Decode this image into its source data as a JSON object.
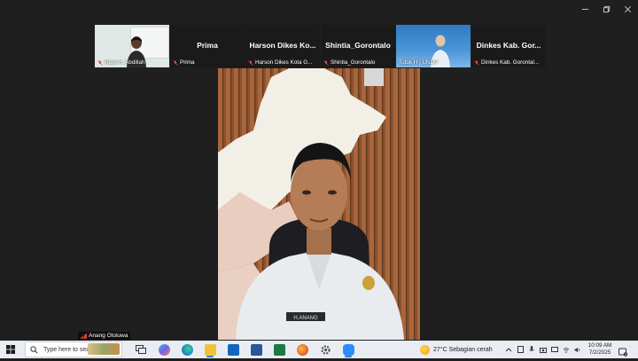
{
  "window": {
    "controls": [
      "minimize",
      "restore",
      "close"
    ]
  },
  "participants": [
    {
      "name": "Rizki H. Abdillah",
      "big_name": "",
      "has_video": true,
      "muted": true
    },
    {
      "name": "Prima",
      "big_name": "Prima",
      "has_video": false,
      "muted": true
    },
    {
      "name": "Harson Dikes Kota G...",
      "big_name": "Harson Dikes Ko...",
      "has_video": false,
      "muted": true
    },
    {
      "name": "Shintia_Gorontalo",
      "big_name": "Shintia_Gorontalo",
      "has_video": false,
      "muted": true
    },
    {
      "name": "Totok H | UNDP",
      "big_name": "",
      "has_video": true,
      "muted": false
    },
    {
      "name": "Dinkes Kab. Gorontal...",
      "big_name": "Dinkes Kab. Gor...",
      "has_video": false,
      "muted": true
    }
  ],
  "speaker": {
    "name": "Anang Otoluwa",
    "name_tag": "H.ANANG"
  },
  "taskbar": {
    "search_placeholder": "Type here to search",
    "weather": "27°C  Sebagian cerah",
    "time": "10:09 AM",
    "date": "7/2/2025",
    "notification_count": "3",
    "apps": [
      {
        "name": "task-view-icon",
        "color": "#3a3a3a"
      },
      {
        "name": "copilot-icon",
        "color": "#5aa0f0"
      },
      {
        "name": "edge-icon",
        "color": "#1e88c8"
      },
      {
        "name": "file-explorer-icon",
        "color": "#f2c237"
      },
      {
        "name": "outlook-icon",
        "color": "#1565c0"
      },
      {
        "name": "lync-icon",
        "color": "#2b579a"
      },
      {
        "name": "excel-icon",
        "color": "#1d7a45"
      },
      {
        "name": "firefox-icon",
        "color": "#e8662a"
      },
      {
        "name": "settings-icon",
        "color": "#555555"
      },
      {
        "name": "zoom-icon",
        "color": "#2d8cff"
      }
    ]
  },
  "colors": {
    "background": "#1f1f1f",
    "muted_red": "#e0463d",
    "taskbar": "#e9edf3"
  }
}
